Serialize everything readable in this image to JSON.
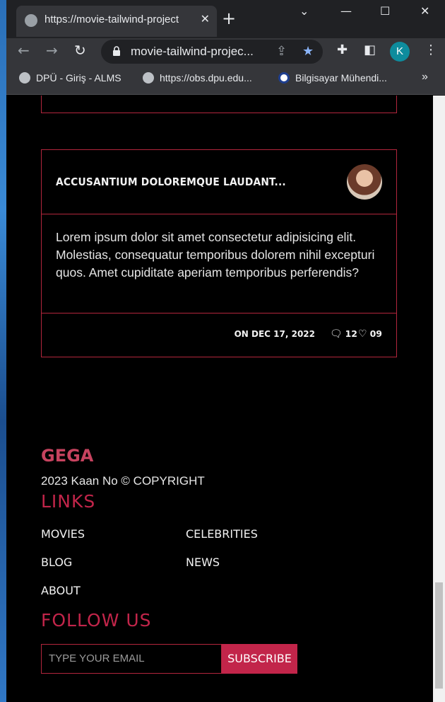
{
  "browser": {
    "tab_title": "https://movie-tailwind-project",
    "tab_close": "✕",
    "new_tab": "+",
    "url": "movie-tailwind-projec...",
    "profile_initial": "K",
    "bookmarks": [
      {
        "label": "DPÜ - Giriş - ALMS"
      },
      {
        "label": "https://obs.dpu.edu..."
      },
      {
        "label": "Bilgisayar Mühendi..."
      }
    ],
    "more_bookmarks": "»"
  },
  "card": {
    "title": "ACCUSANTIUM DOLOREMQUE LAUDANT...",
    "body": "Lorem ipsum dolor sit amet consectetur adipisicing elit. Molestias, consequatur temporibus dolorem nihil excepturi quos. Amet cupiditate aperiam temporibus perferendis?",
    "date": "ON DEC 17, 2022",
    "comments": "12",
    "likes": "09"
  },
  "footer": {
    "brand": "GEGA",
    "copyright": "2023 Kaan No © COPYRIGHT",
    "links_title": "LINKS",
    "links": [
      "MOVIES",
      "CELEBRITIES",
      "BLOG",
      "NEWS",
      "ABOUT"
    ],
    "follow_title": "FOLLOW US",
    "email_placeholder": "TYPE YOUR EMAIL",
    "subscribe_label": "SUBSCRIBE"
  },
  "colors": {
    "accent": "#c2254a",
    "border": "#b3263d",
    "brand": "#c7435f"
  }
}
